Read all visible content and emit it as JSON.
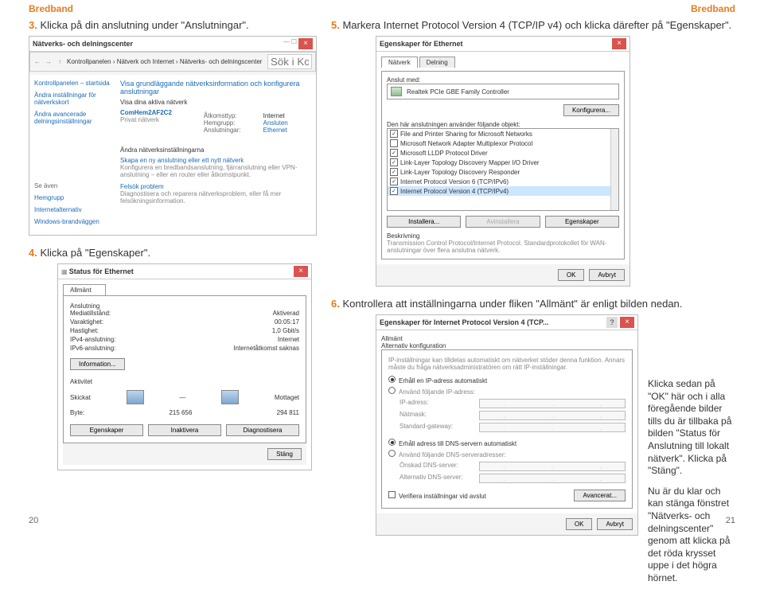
{
  "header": {
    "left": "Bredband",
    "right": "Bredband"
  },
  "footer": {
    "left": "20",
    "right": "21"
  },
  "step3": {
    "num": "3.",
    "text": "Klicka på din anslutning under \"Anslutningar\"."
  },
  "step4": {
    "num": "4.",
    "text": "Klicka på \"Egenskaper\"."
  },
  "step5": {
    "num": "5.",
    "text": "Markera Internet Protocol Version 4 (TCP/IP v4) och klicka därefter på \"Egenskaper\"."
  },
  "step6": {
    "num": "6.",
    "text": "Kontrollera att inställningarna under fliken \"Allmänt\" är enligt bilden nedan."
  },
  "ncenter": {
    "title": "Nätverks- och delningscenter",
    "breadcrumb": "Kontrollpanelen › Nätverk och Internet › Nätverks- och delningscenter",
    "search_placeholder": "Sök i Kont…",
    "leftnav": {
      "home": "Kontrollpanelen – startsida",
      "adapter": "Ändra inställningar för nätverkskort",
      "sharing": "Ändra avancerade delningsinställningar"
    },
    "see_also_head": "Se även",
    "see_also": [
      "Hemgrupp",
      "Internetalternativ",
      "Windows-brandväggen"
    ],
    "heading": "Visa grundläggande nätverksinformation och konfigurera anslutningar",
    "active_heading": "Visa dina aktiva nätverk",
    "net_name": "ComHem2AF2C2",
    "net_type": "Privat nätverk",
    "labels": {
      "access": "Åtkomsttyp:",
      "homegroup": "Hemgrupp:",
      "connections": "Anslutningar:"
    },
    "values": {
      "access": "Internet",
      "homegroup": "Ansluten",
      "connections": "Ethernet"
    },
    "change_heading": "Ändra nätverksinställningarna",
    "new_conn": "Skapa en ny anslutning eller ett nytt nätverk",
    "new_conn_sub": "Konfigurera en bredbandsanslutning, fjärranslutning eller VPN-anslutning – eller en router eller åtkomstpunkt.",
    "troubleshoot": "Felsök problem",
    "troubleshoot_sub": "Diagnostisera och reparera nätverksproblem, eller få mer felsökningsinformation."
  },
  "eprops": {
    "title": "Egenskaper för Ethernet",
    "tabs": {
      "net": "Nätverk",
      "share": "Delning"
    },
    "connect_with": "Anslut med:",
    "adapter": "Realtek PCIe GBE Family Controller",
    "configure": "Konfigurera...",
    "uses_heading": "Den här anslutningen använder följande objekt:",
    "items": [
      {
        "checked": true,
        "label": "File and Printer Sharing for Microsoft Networks"
      },
      {
        "checked": false,
        "label": "Microsoft Network Adapter Multiplexor Protocol"
      },
      {
        "checked": true,
        "label": "Microsoft LLDP Protocol Driver"
      },
      {
        "checked": true,
        "label": "Link-Layer Topology Discovery Mapper I/O Driver"
      },
      {
        "checked": true,
        "label": "Link-Layer Topology Discovery Responder"
      },
      {
        "checked": true,
        "label": "Internet Protocol Version 6 (TCP/IPv6)"
      },
      {
        "checked": true,
        "label": "Internet Protocol Version 4 (TCP/IPv4)"
      }
    ],
    "install": "Installera...",
    "uninstall": "Avinstallera",
    "properties": "Egenskaper",
    "desc_head": "Beskrivning",
    "desc_body": "Transmission Control Protocol/Internet Protocol. Standardprotokollet för WAN-anslutningar över flera anslutna nätverk.",
    "ok": "OK",
    "cancel": "Avbryt"
  },
  "status": {
    "title": "Status för Ethernet",
    "tab": "Allmänt",
    "conn_head": "Anslutning",
    "rows": {
      "state_k": "Mediatillstånd:",
      "state_v": "Aktiverad",
      "dur_k": "Varaktighet:",
      "dur_v": "00:05:17",
      "speed_k": "Hastighet:",
      "speed_v": "1,0 Gbit/s",
      "ipv4_k": "IPv4-anslutning:",
      "ipv4_v": "Internet",
      "ipv6_k": "IPv6-anslutning:",
      "ipv6_v": "Internetåtkomst saknas"
    },
    "info": "Information...",
    "activity_head": "Aktivitet",
    "sent": "Skickat",
    "recv": "Mottaget",
    "byte_label": "Byte:",
    "byte_sent": "215 656",
    "byte_recv": "294 811",
    "props": "Egenskaper",
    "disable": "Inaktivera",
    "diag": "Diagnostisera",
    "close": "Stäng"
  },
  "iprops": {
    "title": "Egenskaper för Internet Protocol Version 4 (TCP...",
    "tab_general": "Allmänt",
    "tab_alt": "Alternativ konfiguration",
    "intro": "IP-inställningar kan tilldelas automatiskt om nätverket stöder denna funktion. Annars måste du fråga nätverksadministratören om rätt IP-inställningar.",
    "auto_ip": "Erhåll en IP-adress automatiskt",
    "man_ip": "Använd följande IP-adress:",
    "ip_label": "IP-adress:",
    "mask_label": "Nätmask:",
    "gw_label": "Standard-gateway:",
    "auto_dns": "Erhåll adress till DNS-servern automatiskt",
    "man_dns": "Använd följande DNS-serveradresser:",
    "dns1_label": "Önskad DNS-server:",
    "dns2_label": "Alternativ DNS-server:",
    "validate": "Verifiera inställningar vid avslut",
    "advanced": "Avancerat...",
    "ok": "OK",
    "cancel": "Avbryt"
  },
  "note": {
    "p1": "Klicka sedan på \"OK\" här och i alla föregående bilder tills du är tillbaka på bilden \"Status för Anslutning till lokalt nätverk\". Klicka på \"Stäng\".",
    "p2": "Nu är du klar och kan stänga fönstret \"Nätverks- och delningscenter\" genom att klicka på det röda krysset uppe i det högra hörnet."
  }
}
